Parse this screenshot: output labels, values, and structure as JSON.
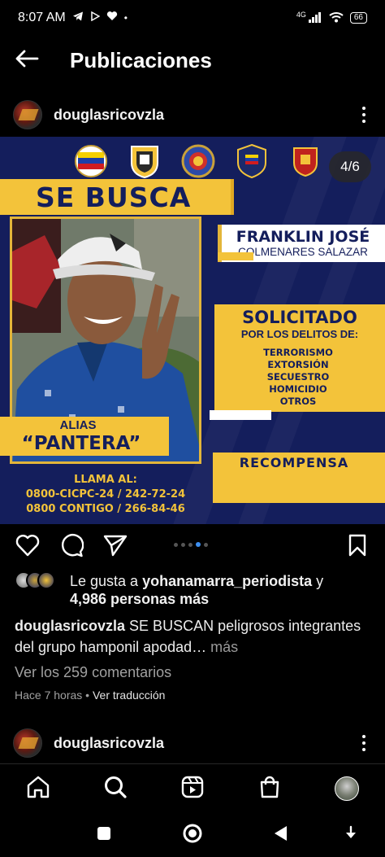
{
  "status_bar": {
    "time": "8:07 AM",
    "network": "4G",
    "battery": "66"
  },
  "header": {
    "title": "Publicaciones"
  },
  "post": {
    "username": "douglasricovzla",
    "carousel_counter": "4/6",
    "carousel": {
      "total": 6,
      "current": 4
    },
    "poster": {
      "heading": "SE BUSCA",
      "name_line1": "FRANKLIN JOSÉ",
      "name_line2": "COLMENARES SALAZAR",
      "solicitado": "SOLICITADO",
      "por_delitos": "POR LOS DELITOS DE:",
      "crimes": [
        "TERRORISMO",
        "EXTORSIÓN",
        "SECUESTRO",
        "HOMICIDIO",
        "OTROS"
      ],
      "alias_label": "ALIAS",
      "alias_name": "“PANTERA”",
      "recompensa": "RECOMPENSA",
      "call_title": "LLAMA AL:",
      "call_line1": "0800-CICPC-24 / 242-72-24",
      "call_line2": "0800 CONTIGO / 266-84-46"
    },
    "likes": {
      "prefix": "Le gusta a ",
      "user": "yohanamarra_periodista",
      "suffix": " y",
      "others": "4,986 personas más"
    },
    "caption": {
      "user": "douglasricovzla",
      "text": " SE BUSCAN peligrosos integrantes del grupo hamponil apodad…",
      "more": " más"
    },
    "comments_link": "Ver los 259 comentarios",
    "time_ago": "Hace 7 horas",
    "separator": " • ",
    "translate": "Ver traducción"
  },
  "next_post": {
    "username": "douglasricovzla"
  },
  "colors": {
    "poster_navy": "#141e5c",
    "poster_yellow": "#f3c33a",
    "active_dot": "#3d8ff0"
  },
  "icons": {
    "actions": [
      "heart-icon",
      "comment-icon",
      "share-icon",
      "bookmark-icon"
    ],
    "nav": [
      "home-icon",
      "search-icon",
      "reels-icon",
      "shop-icon",
      "profile-avatar"
    ],
    "system": [
      "recents-square-icon",
      "home-circle-icon",
      "back-triangle-icon",
      "nav-toggle-icon"
    ]
  }
}
